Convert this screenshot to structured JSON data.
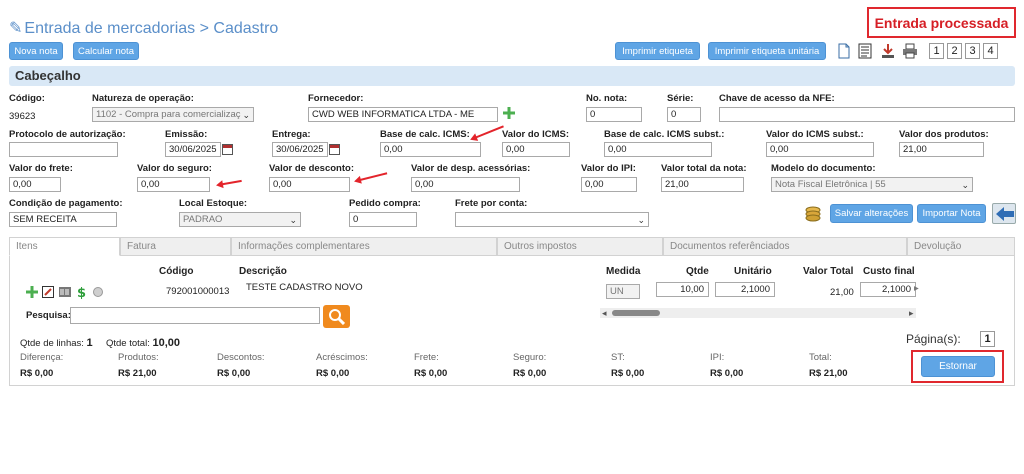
{
  "page": {
    "title": "Entrada de mercadorias > Cadastro",
    "status": "Entrada processada",
    "section_title": "Cabeçalho"
  },
  "toolbar": {
    "new_note": "Nova nota",
    "calc_note": "Calcular nota",
    "print_label": "Imprimir etiqueta",
    "print_unit_label": "Imprimir etiqueta unitária",
    "print_options": [
      "1",
      "2",
      "3",
      "4"
    ]
  },
  "fields": {
    "codigo": {
      "label": "Código:",
      "value": "39623"
    },
    "natureza": {
      "label": "Natureza de operação:",
      "value": "1102 - Compra para comercializaç"
    },
    "fornecedor": {
      "label": "Fornecedor:",
      "value": "CWD WEB INFORMATICA LTDA - ME"
    },
    "no_nota": {
      "label": "No. nota:",
      "value": "0"
    },
    "serie": {
      "label": "Série:",
      "value": "0"
    },
    "chave": {
      "label": "Chave de acesso da NFE:",
      "value": ""
    },
    "protocolo": {
      "label": "Protocolo de autorização:",
      "value": ""
    },
    "emissao": {
      "label": "Emissão:",
      "value": "30/06/2025"
    },
    "entrega": {
      "label": "Entrega:",
      "value": "30/06/2025"
    },
    "base_icms": {
      "label": "Base de calc. ICMS:",
      "value": "0,00"
    },
    "valor_icms": {
      "label": "Valor do ICMS:",
      "value": "0,00"
    },
    "base_icms_subst": {
      "label": "Base de calc. ICMS subst.:",
      "value": "0,00"
    },
    "valor_icms_subst": {
      "label": "Valor do ICMS subst.:",
      "value": "0,00"
    },
    "valor_produtos": {
      "label": "Valor dos produtos:",
      "value": "21,00"
    },
    "valor_frete": {
      "label": "Valor do frete:",
      "value": "0,00"
    },
    "valor_seguro": {
      "label": "Valor do seguro:",
      "value": "0,00"
    },
    "valor_desconto": {
      "label": "Valor de desconto:",
      "value": "0,00"
    },
    "valor_desp": {
      "label": "Valor de desp. acessórias:",
      "value": "0,00"
    },
    "valor_ipi": {
      "label": "Valor do IPI:",
      "value": "0,00"
    },
    "valor_total": {
      "label": "Valor total da nota:",
      "value": "21,00"
    },
    "modelo_doc": {
      "label": "Modelo do documento:",
      "value": "Nota Fiscal Eletrônica | 55"
    },
    "condicao": {
      "label": "Condição de pagamento:",
      "value": "SEM RECEITA"
    },
    "local_estoque": {
      "label": "Local Estoque:",
      "value": "PADRAO"
    },
    "pedido": {
      "label": "Pedido compra:",
      "value": "0"
    },
    "frete_conta": {
      "label": "Frete por conta:",
      "value": ""
    }
  },
  "actions": {
    "save": "Salvar alterações",
    "import": "Importar Nota",
    "reverse": "Estornar"
  },
  "tabs": [
    "Itens",
    "Fatura",
    "Informações complementares",
    "Outros impostos",
    "Documentos referênciados",
    "Devolução"
  ],
  "items": {
    "headers": {
      "codigo": "Código",
      "descricao": "Descrição",
      "medida": "Medida",
      "qtde": "Qtde",
      "unitario": "Unitário",
      "valor_total": "Valor Total",
      "custo_final": "Custo final"
    },
    "rows": [
      {
        "codigo": "792001000013",
        "descricao": "TESTE CADASTRO NOVO",
        "medida": "UN",
        "qtde": "10,00",
        "unitario": "2,1000",
        "valor_total": "21,00",
        "custo_final": "2,1000"
      }
    ],
    "search_label": "Pesquisa:",
    "search_value": "",
    "pages_label": "Página(s):",
    "page_current": "1",
    "lines_label": "Qtde de linhas:",
    "lines_value": "1",
    "total_qty_label": "Qtde total:",
    "total_qty_value": "10,00"
  },
  "totals": [
    {
      "label": "Diferença:",
      "value": "R$ 0,00"
    },
    {
      "label": "Produtos:",
      "value": "R$ 21,00"
    },
    {
      "label": "Descontos:",
      "value": "R$ 0,00"
    },
    {
      "label": "Acréscimos:",
      "value": "R$ 0,00"
    },
    {
      "label": "Frete:",
      "value": "R$ 0,00"
    },
    {
      "label": "Seguro:",
      "value": "R$ 0,00"
    },
    {
      "label": "ST:",
      "value": "R$ 0,00"
    },
    {
      "label": "IPI:",
      "value": "R$ 0,00"
    },
    {
      "label": "Total:",
      "value": "R$ 21,00"
    }
  ],
  "colors": {
    "accent": "#5fa5e5",
    "alert": "#e0282e",
    "section": "#d9e8f6"
  }
}
